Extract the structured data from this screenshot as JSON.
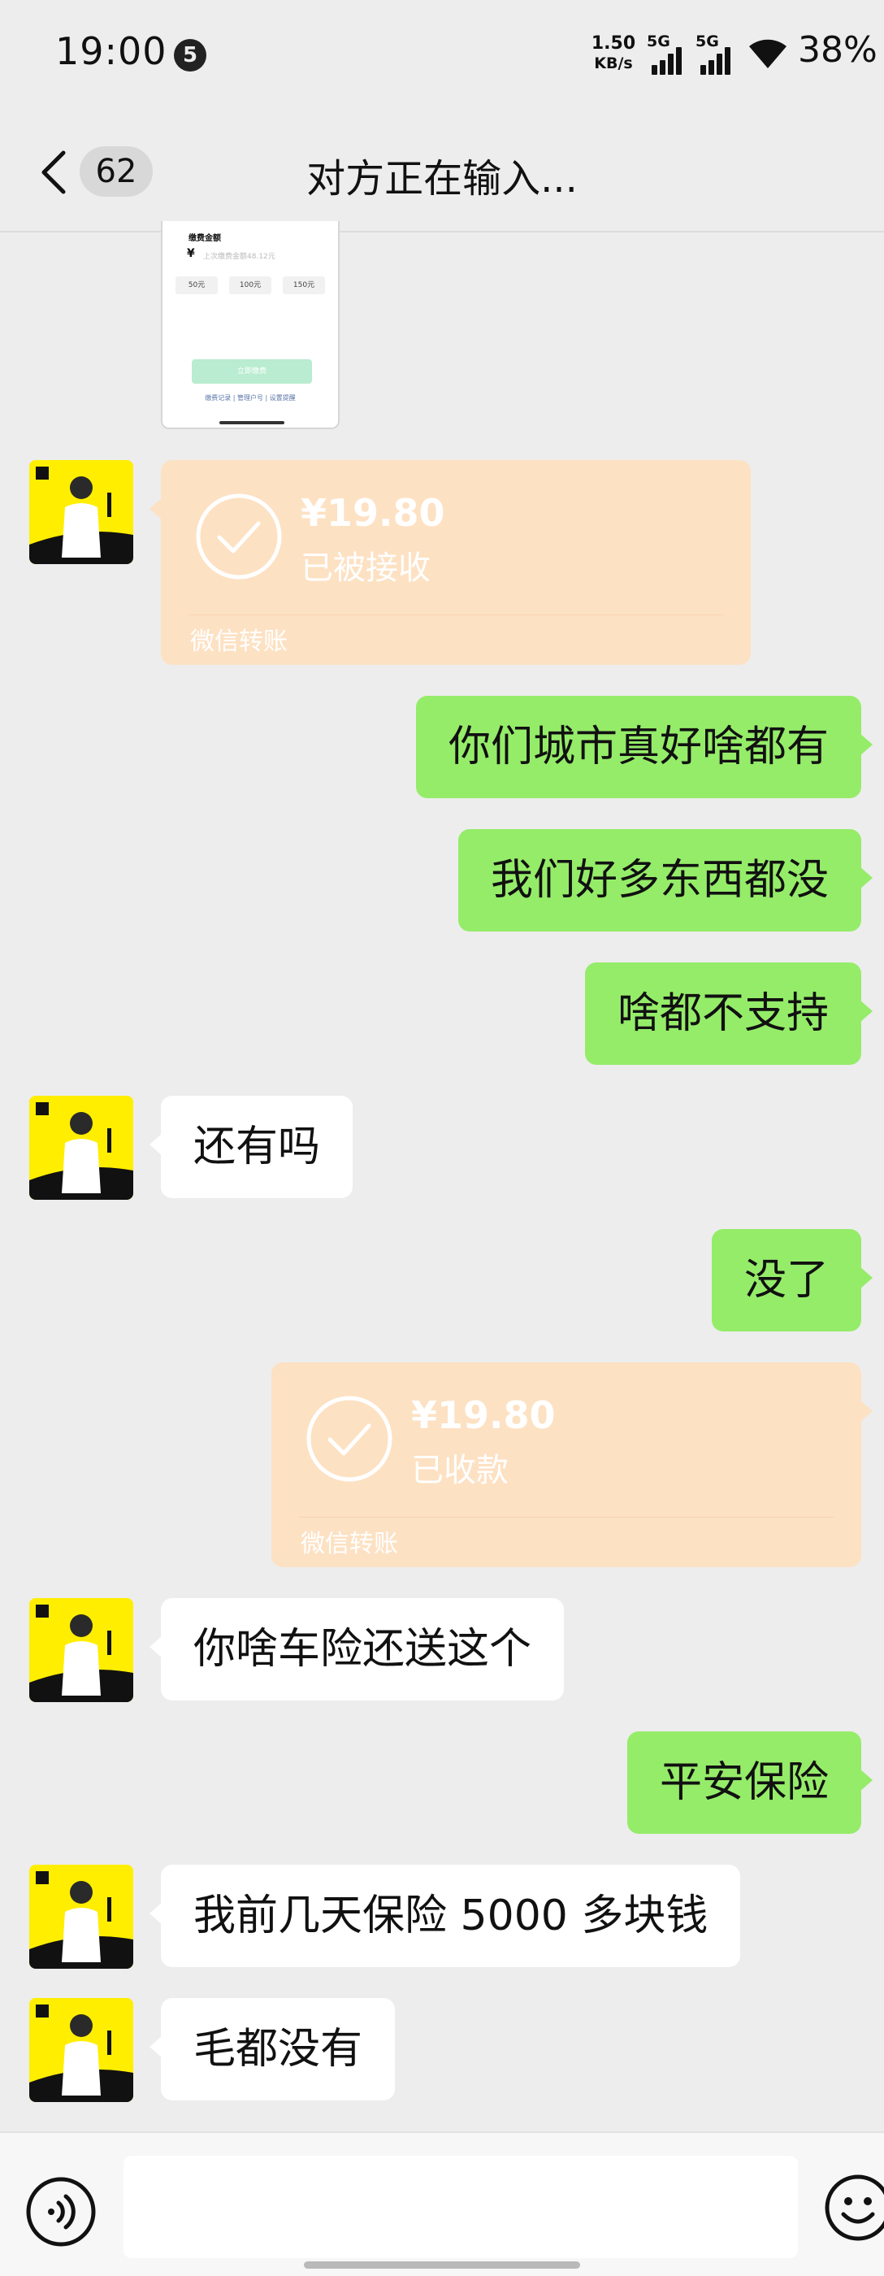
{
  "status_bar": {
    "time": "19:00",
    "notification_count": "5",
    "net_speed_value": "1.50",
    "net_speed_unit": "KB/s",
    "signal_1_label": "5G",
    "signal_2_label": "5G",
    "battery": "38%"
  },
  "header": {
    "unread_count": "62",
    "title": "对方正在输入..."
  },
  "shared_image": {
    "title": "缴费金额",
    "currency": "¥",
    "placeholder": "上次缴费金额48.12元",
    "chips": [
      "50元",
      "100元",
      "150元"
    ],
    "button": "立即缴费",
    "links": "缴费记录 | 管理户号 | 设置提醒"
  },
  "messages": {
    "transfer_1": {
      "amount": "¥19.80",
      "status": "已被接收",
      "label": "微信转账"
    },
    "msg_1": "你们城市真好啥都有",
    "msg_2": "我们好多东西都没",
    "msg_3": "啥都不支持",
    "msg_4": "还有吗",
    "msg_5": "没了",
    "transfer_2": {
      "amount": "¥19.80",
      "status": "已收款",
      "label": "微信转账"
    },
    "msg_6": "你啥车险还送这个",
    "msg_7": "平安保险",
    "msg_8": "我前几天保险 5000 多块钱",
    "msg_9": "毛都没有"
  },
  "colors": {
    "background": "#ededed",
    "sent_bubble": "#95ec69",
    "received_bubble": "#ffffff",
    "transfer_card": "#fde1c3",
    "avatar_yellow": "#ffee00"
  },
  "icons": [
    "back-icon",
    "wifi-icon",
    "check-icon",
    "voice-icon",
    "emoji-icon"
  ]
}
